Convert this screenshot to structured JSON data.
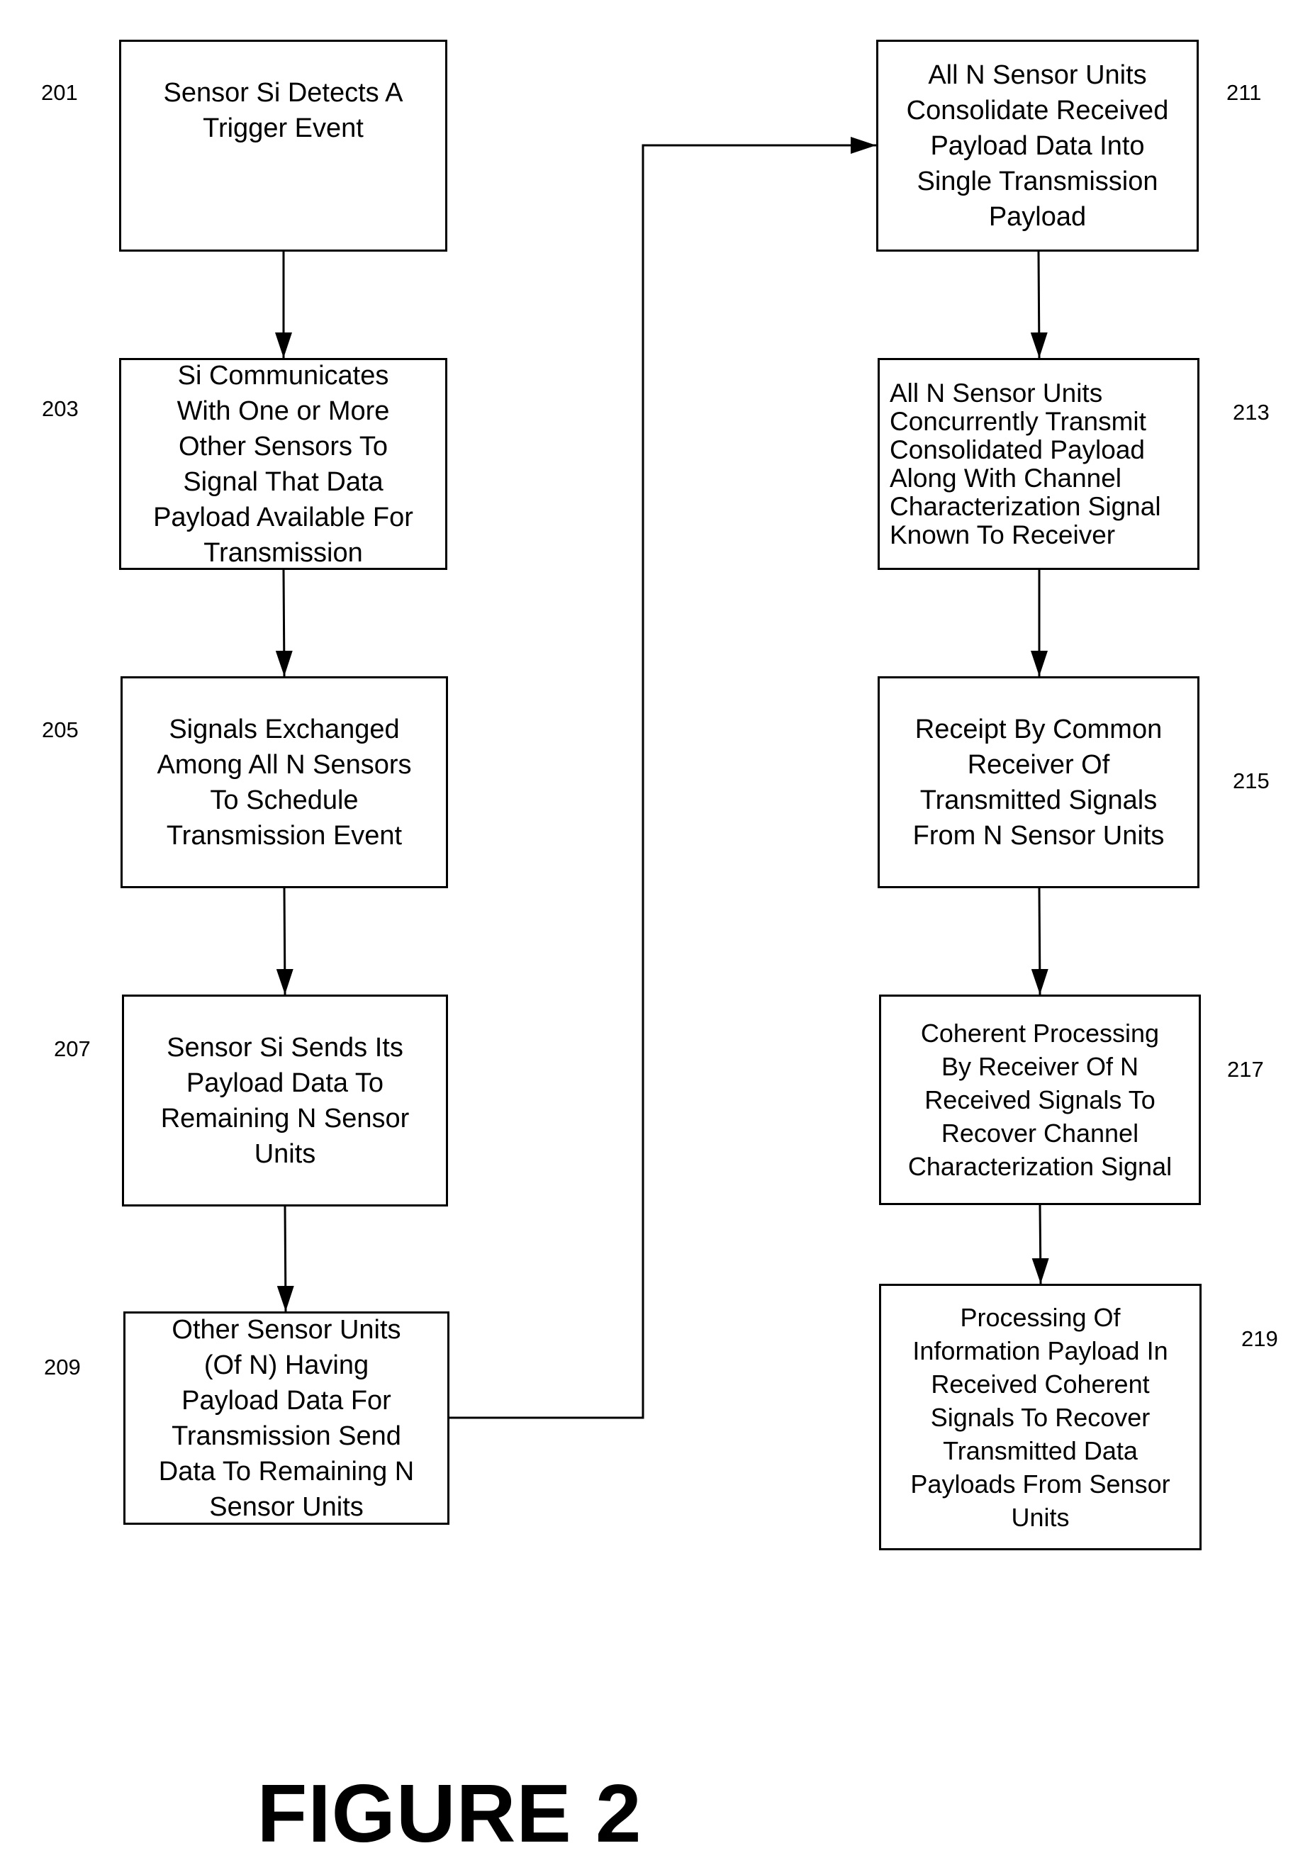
{
  "figure": {
    "title": "FIGURE 2"
  },
  "steps": [
    {
      "id": "201",
      "ref": "201",
      "text": "Sensor Si Detects A\nTrigger Event"
    },
    {
      "id": "203",
      "ref": "203",
      "text": "Si Communicates\nWith One or More\nOther Sensors To\nSignal That Data\nPayload Available For\nTransmission"
    },
    {
      "id": "205",
      "ref": "205",
      "text": "Signals Exchanged\nAmong All N Sensors\nTo Schedule\nTransmission Event"
    },
    {
      "id": "207",
      "ref": "207",
      "text": "Sensor Si Sends Its\nPayload Data To\nRemaining N Sensor\nUnits"
    },
    {
      "id": "209",
      "ref": "209",
      "text": "Other Sensor Units\n(Of N) Having\nPayload Data For\nTransmission Send\nData To Remaining N\nSensor Units"
    },
    {
      "id": "211",
      "ref": "211",
      "text": "All N Sensor Units\nConsolidate Received\nPayload Data Into\nSingle Transmission\nPayload"
    },
    {
      "id": "213",
      "ref": "213",
      "text": "All N Sensor Units\nConcurrently Transmit\nConsolidated Payload\nAlong With Channel\nCharacterization Signal\nKnown To Receiver"
    },
    {
      "id": "215",
      "ref": "215",
      "text": "Receipt By Common\nReceiver Of\nTransmitted Signals\nFrom N Sensor Units"
    },
    {
      "id": "217",
      "ref": "217",
      "text": "Coherent Processing\nBy Receiver Of N\nReceived Signals To\nRecover Channel\nCharacterization Signal"
    },
    {
      "id": "219",
      "ref": "219",
      "text": "Processing Of\nInformation Payload In\nReceived Coherent\nSignals To Recover\nTransmitted Data\nPayloads From Sensor\nUnits"
    }
  ],
  "flow": [
    [
      "201",
      "203"
    ],
    [
      "203",
      "205"
    ],
    [
      "205",
      "207"
    ],
    [
      "207",
      "209"
    ],
    [
      "209",
      "211"
    ],
    [
      "211",
      "213"
    ],
    [
      "213",
      "215"
    ],
    [
      "215",
      "217"
    ],
    [
      "217",
      "219"
    ]
  ]
}
